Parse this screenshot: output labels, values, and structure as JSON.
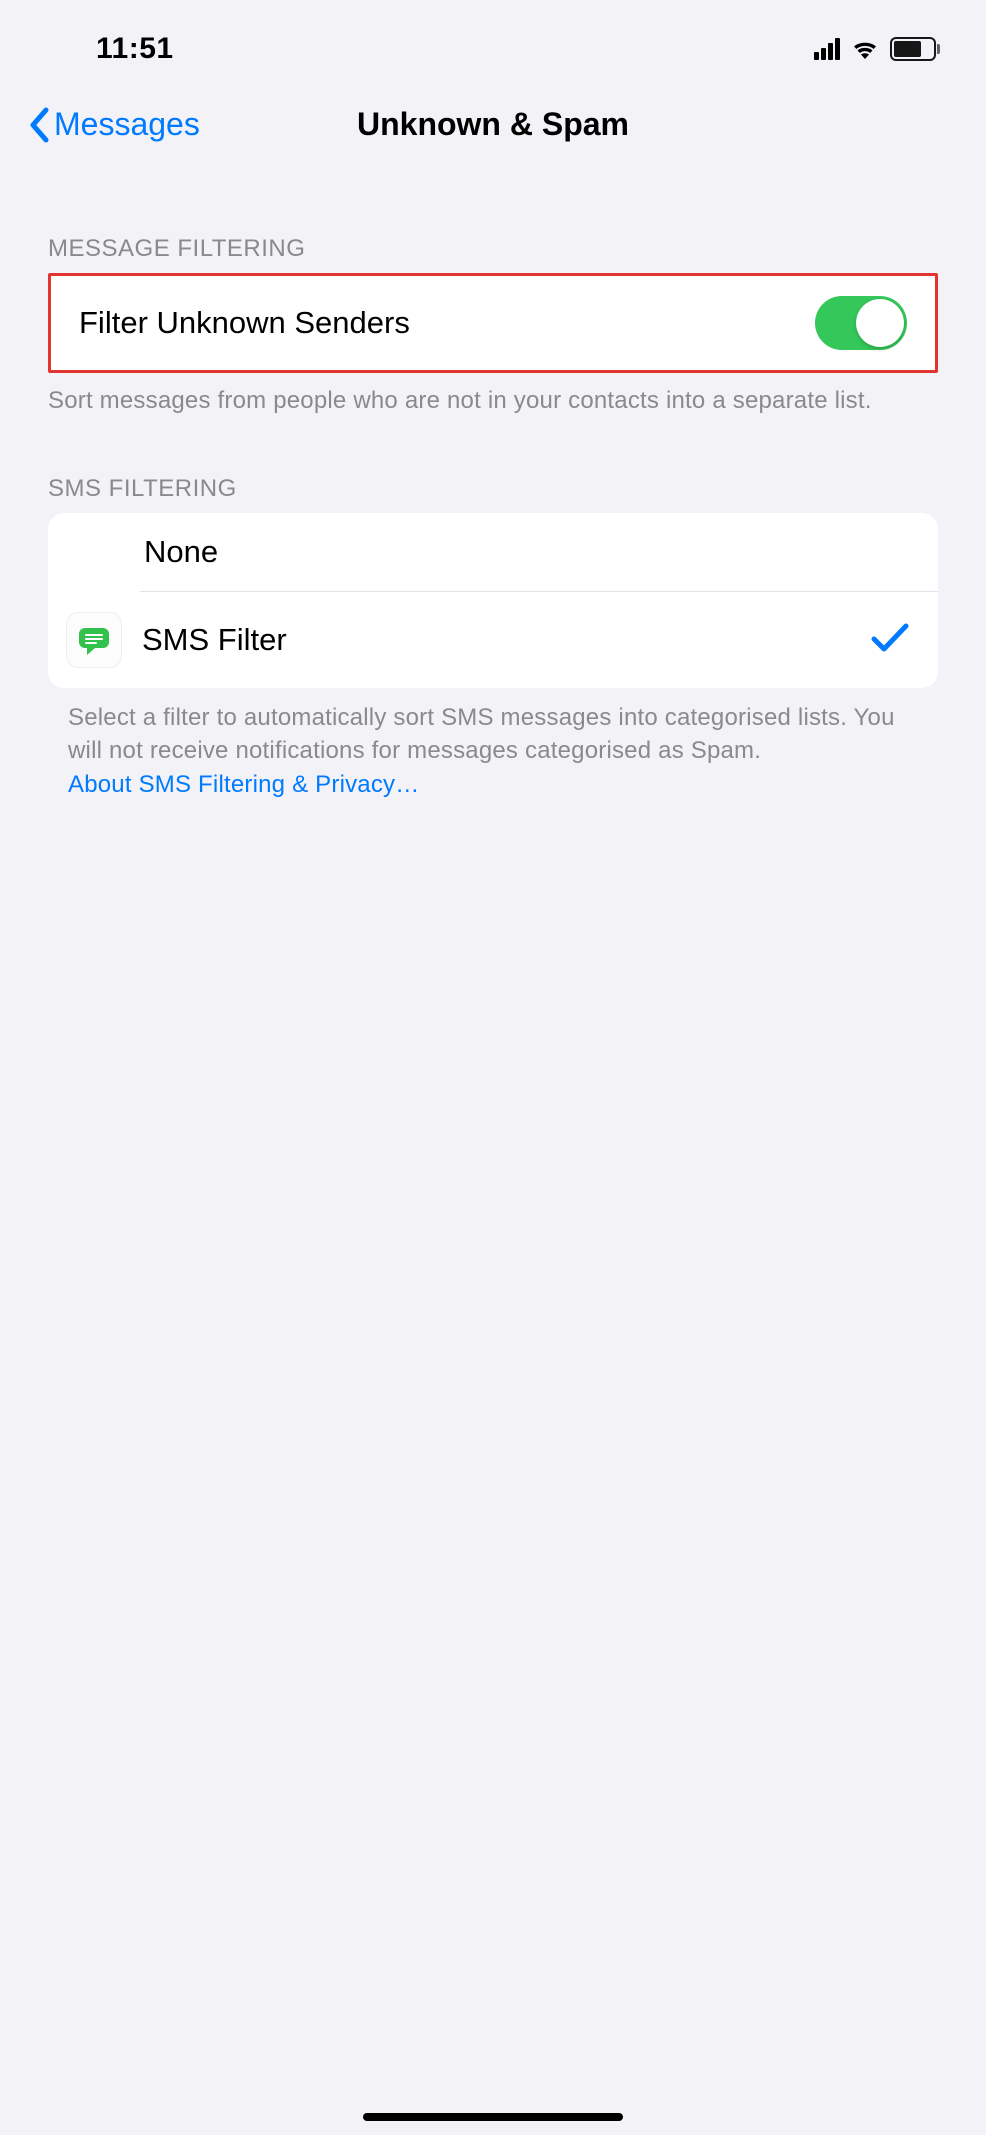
{
  "status": {
    "time": "11:51"
  },
  "nav": {
    "back_label": "Messages",
    "title": "Unknown & Spam"
  },
  "sections": {
    "message_filtering": {
      "header": "MESSAGE FILTERING",
      "rows": {
        "filter_unknown": {
          "label": "Filter Unknown Senders",
          "toggle_on": true
        }
      },
      "footer": "Sort messages from people who are not in your contacts into a separate list."
    },
    "sms_filtering": {
      "header": "SMS FILTERING",
      "rows": {
        "none": {
          "label": "None",
          "selected": false
        },
        "sms_filter": {
          "label": "SMS Filter",
          "selected": true
        }
      },
      "footer": "Select a filter to automatically sort SMS messages into categorised lists. You will not receive notifications for messages categorised as Spam.",
      "footer_link": "About SMS Filtering & Privacy…"
    }
  }
}
